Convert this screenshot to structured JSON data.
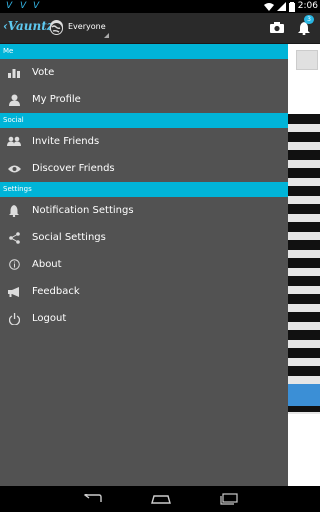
{
  "status_bar": {
    "notification_icons": [
      "V",
      "V",
      "V"
    ],
    "time": "2:06"
  },
  "action_bar": {
    "logo": "‹Vauntz",
    "audience": "Everyone",
    "notification_count": "3"
  },
  "drawer": {
    "sections": [
      {
        "header": "Me",
        "items": [
          {
            "label": "Vote",
            "icon": "bar-chart-icon"
          },
          {
            "label": "My Profile",
            "icon": "person-icon"
          }
        ]
      },
      {
        "header": "Social",
        "items": [
          {
            "label": "Invite Friends",
            "icon": "group-icon"
          },
          {
            "label": "Discover Friends",
            "icon": "eye-icon"
          }
        ]
      },
      {
        "header": "Settings",
        "items": [
          {
            "label": "Notification Settings",
            "icon": "bell-icon"
          },
          {
            "label": "Social Settings",
            "icon": "share-icon"
          },
          {
            "label": "About",
            "icon": "info-icon"
          },
          {
            "label": "Feedback",
            "icon": "megaphone-icon"
          },
          {
            "label": "Logout",
            "icon": "power-icon"
          }
        ]
      }
    ]
  },
  "colors": {
    "accent": "#00b4d8",
    "drawer_bg": "#525252",
    "action_bar": "#2a2a2a"
  }
}
